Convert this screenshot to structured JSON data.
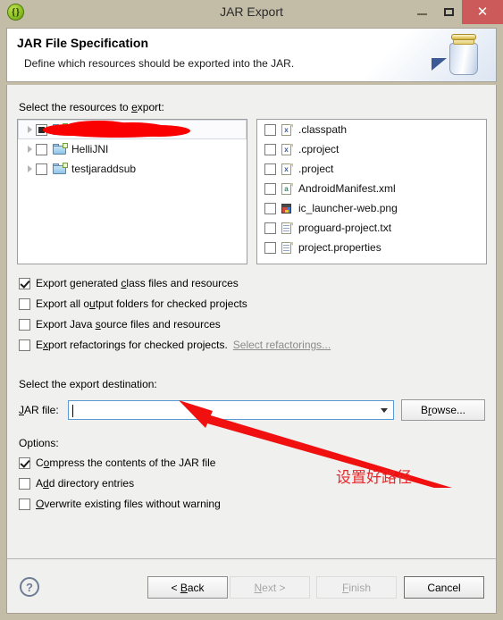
{
  "window": {
    "title": "JAR Export",
    "app_icon": "eclipse-braces-icon",
    "minimize_label": "",
    "maximize_label": "",
    "close_label": "✕",
    "titlebar_color": "#c3bca6",
    "close_color": "#cc5a5a"
  },
  "banner": {
    "title": "JAR File Specification",
    "subtitle": "Define which resources should be exported into the JAR.",
    "art": "jar-with-arrow-icon"
  },
  "resources": {
    "label_pre": "Select the resources to ",
    "label_mn": "e",
    "label_post": "xport:",
    "tree": [
      {
        "label": "",
        "checkbox": "partial",
        "redacted": true,
        "selected": true,
        "expandable": true
      },
      {
        "label": "HelliJNI",
        "checkbox": "unchecked",
        "redacted": false,
        "selected": false,
        "expandable": true
      },
      {
        "label": "testjaraddsub",
        "checkbox": "unchecked",
        "redacted": false,
        "selected": false,
        "expandable": true
      }
    ],
    "files": [
      {
        "label": ".classpath",
        "icon": "xml-x-file-icon",
        "checkbox": "unchecked"
      },
      {
        "label": ".cproject",
        "icon": "xml-x-file-icon",
        "checkbox": "unchecked"
      },
      {
        "label": ".project",
        "icon": "xml-x-file-icon",
        "checkbox": "unchecked"
      },
      {
        "label": "AndroidManifest.xml",
        "icon": "android-xml-file-icon",
        "checkbox": "unchecked"
      },
      {
        "label": "ic_launcher-web.png",
        "icon": "image-file-icon",
        "checkbox": "unchecked"
      },
      {
        "label": "proguard-project.txt",
        "icon": "text-file-icon",
        "checkbox": "unchecked"
      },
      {
        "label": "project.properties",
        "icon": "text-file-icon",
        "checkbox": "unchecked"
      }
    ]
  },
  "export_options": [
    {
      "pre": "Export generated ",
      "mn": "c",
      "post": "lass files and resources",
      "checked": true
    },
    {
      "pre": "Export all o",
      "mn": "u",
      "post": "tput folders for checked projects",
      "checked": false
    },
    {
      "pre": "Export Java ",
      "mn": "s",
      "post": "ource files and resources",
      "checked": false
    },
    {
      "pre": "E",
      "mn": "x",
      "post": "port refactorings for checked projects.",
      "checked": false,
      "link": "Select refactorings..."
    }
  ],
  "destination": {
    "label": "Select the export destination:",
    "jarfile_label_pre": "",
    "jarfile_label_mn": "J",
    "jarfile_label_post": "AR file:",
    "jarfile_value": "",
    "jarfile_placeholder": "",
    "browse_label_pre": "B",
    "browse_label_mn": "r",
    "browse_label_post": "owse..."
  },
  "options": {
    "label": "Options:",
    "items": [
      {
        "pre": "C",
        "mn": "o",
        "post": "mpress the contents of the JAR file",
        "checked": true
      },
      {
        "pre": "A",
        "mn": "d",
        "post": "d directory entries",
        "checked": false
      },
      {
        "pre": "",
        "mn": "O",
        "post": "verwrite existing files without warning",
        "checked": false
      }
    ]
  },
  "annotation": {
    "text": "设置好路径",
    "color": "#e8262a",
    "arrow": "red-arrow-pointing-to-jar-file-field"
  },
  "footer": {
    "help_label": "?",
    "buttons": [
      {
        "pre": "< ",
        "mn": "B",
        "post": "ack",
        "state": "enabled"
      },
      {
        "pre": "",
        "mn": "N",
        "post": "ext >",
        "state": "disabled"
      },
      {
        "pre": "",
        "mn": "F",
        "post": "inish",
        "state": "disabled"
      },
      {
        "pre": "Cancel",
        "mn": "",
        "post": "",
        "state": "default"
      }
    ]
  }
}
